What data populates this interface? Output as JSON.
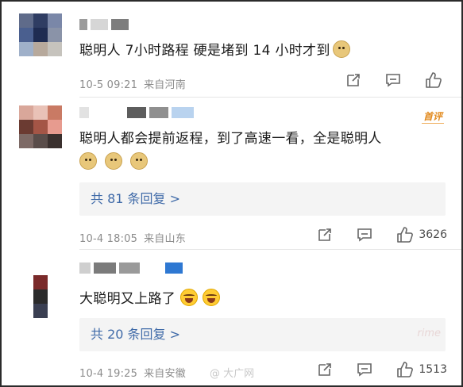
{
  "comments": [
    {
      "text": "聪明人 7小时路程 硬是堵到 14 小时才到",
      "emojis": [
        "doge"
      ],
      "timestamp": "10-5 09:21",
      "location": "来自河南",
      "like_count": ""
    },
    {
      "badge": "首评",
      "text": "聪明人都会提前返程，到了高速一看，全是聪明人",
      "emojis": [
        "doge",
        "doge",
        "doge"
      ],
      "replies_label": "共 81 条回复 >",
      "timestamp": "10-4 18:05",
      "location": "来自山东",
      "like_count": "3626"
    },
    {
      "text": "大聪明又上路了",
      "emojis": [
        "laugh",
        "laugh"
      ],
      "replies_label": "共 20 条回复 >",
      "timestamp": "10-4 19:25",
      "location": "来自安徽",
      "like_count": "1513"
    }
  ],
  "watermark": {
    "corner_text": "rime",
    "center_text": "@ 大广网"
  },
  "colors": {
    "link_blue": "#3f6aa8",
    "meta_gray": "#8c8c8c",
    "badge_orange": "#e28a1e",
    "reply_bg": "#f4f4f4"
  }
}
